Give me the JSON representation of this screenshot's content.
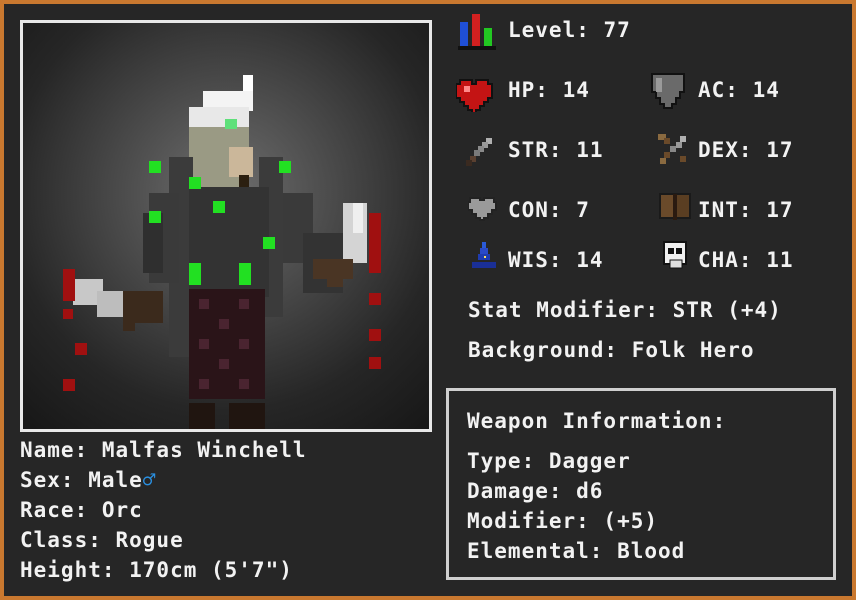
{
  "character": {
    "name_line": "Name: Malfas Winchell",
    "sex_line": "Sex: Male",
    "sex_symbol": "♂",
    "race_line": "Race: Orc",
    "class_line": "Class: Rogue",
    "height_line": "Height: 170cm (5'7\")"
  },
  "stats": {
    "level": "Level: 77",
    "hp": "HP: 14",
    "ac": "AC: 14",
    "str": "STR: 11",
    "dex": "DEX: 17",
    "con": "CON: 7",
    "int": "INT: 17",
    "wis": "WIS: 14",
    "cha": "CHA: 11",
    "stat_modifier": "Stat Modifier: STR (+4)",
    "background": "Background: Folk Hero"
  },
  "weapon": {
    "title": "Weapon Information:",
    "type": "Type: Dagger",
    "damage": "Damage: d6",
    "modifier": "Modifier: (+5)",
    "elemental": "Elemental: Blood"
  },
  "icons": {
    "level": "bar-chart-icon",
    "hp": "heart-icon",
    "ac": "shield-icon",
    "str": "sword-icon",
    "dex": "bow-icon",
    "con": "gray-heart-icon",
    "int": "book-icon",
    "wis": "wizard-hat-icon",
    "cha": "skull-mask-icon"
  },
  "colors": {
    "frame": "#c9782f",
    "panel": "#262626",
    "accent_green": "#22e022",
    "blood_red": "#a01010",
    "male_symbol": "#2a8fe0"
  }
}
